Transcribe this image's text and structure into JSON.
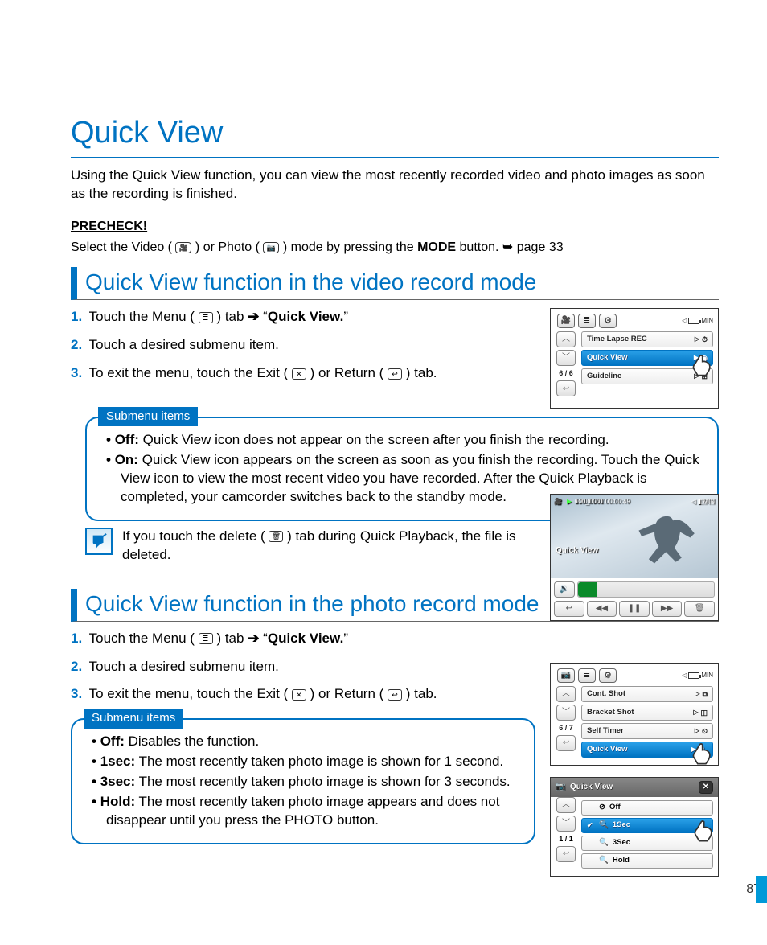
{
  "title": "Quick View",
  "intro": "Using the Quick View function, you can view the most recently recorded video and photo images as soon as the recording is finished.",
  "precheck_label": "PRECHECK!",
  "precheck": {
    "a": "Select the Video (",
    "b": ") or Photo (",
    "c": ") mode by pressing the ",
    "mode": "MODE",
    "d": " button. ",
    "arrow": "➥",
    "e": "page 33"
  },
  "sec1": {
    "heading": "Quick View function in the video record mode",
    "steps": {
      "s1a": "Touch the Menu (",
      "s1b": ") tab ",
      "s1arrow": "➔",
      "s1c": "“",
      "s1d": "Quick View.",
      "s1e": "”",
      "s2": "Touch a desired submenu item.",
      "s3a": "To exit the menu, touch the Exit (",
      "s3b": ") or Return (",
      "s3c": ") tab."
    },
    "submenu_label": "Submenu items",
    "off_label": "Off:",
    "off_text": " Quick View icon does not appear on the screen after you finish the recording.",
    "on_label": "On:",
    "on_text": " Quick View icon appears on the screen as soon as you finish the recording. Touch the Quick View icon to view the most recent video you have recorded. After the Quick Playback is completed, your camcorder switches back to the standby mode.",
    "note_a": "If you touch the delete (",
    "note_b": ") tab during Quick Playback, the file is deleted."
  },
  "panel1": {
    "batt_text": "MIN",
    "rows": [
      "Time Lapse REC",
      "Quick View",
      "Guideline"
    ],
    "page": "6 / 6"
  },
  "playback": {
    "time": "00:00:04 / 00:00:49",
    "counter": "100_0001",
    "label": "Quick View",
    "batt": "MIN"
  },
  "sec2": {
    "heading": "Quick View function in the photo record mode",
    "steps": {
      "s1a": "Touch the Menu (",
      "s1b": ") tab ",
      "s1arrow": "➔",
      "s1c": "“",
      "s1d": "Quick View.",
      "s1e": "”",
      "s2": "Touch a desired submenu item.",
      "s3a": "To exit the menu, touch the Exit (",
      "s3b": ") or Return (",
      "s3c": ") tab."
    },
    "submenu_label": "Submenu items",
    "items": {
      "off_l": "Off:",
      "off_t": " Disables the function.",
      "s1_l": "1sec:",
      "s1_t": " The most recently taken photo image is shown for 1 second.",
      "s3_l": "3sec:",
      "s3_t": " The most recently taken photo image is shown for 3 seconds.",
      "h_l": "Hold:",
      "h_t": " The most recently taken photo image appears and does not disappear until you press the PHOTO button."
    }
  },
  "panel2": {
    "rows": [
      "Cont. Shot",
      "Bracket Shot",
      "Self Timer",
      "Quick View"
    ],
    "page": "6 / 7",
    "batt_text": "MIN"
  },
  "panel3": {
    "title": "Quick View",
    "opts": [
      "Off",
      "1Sec",
      "3Sec",
      "Hold"
    ],
    "page": "1 / 1"
  },
  "pagenum": "87"
}
